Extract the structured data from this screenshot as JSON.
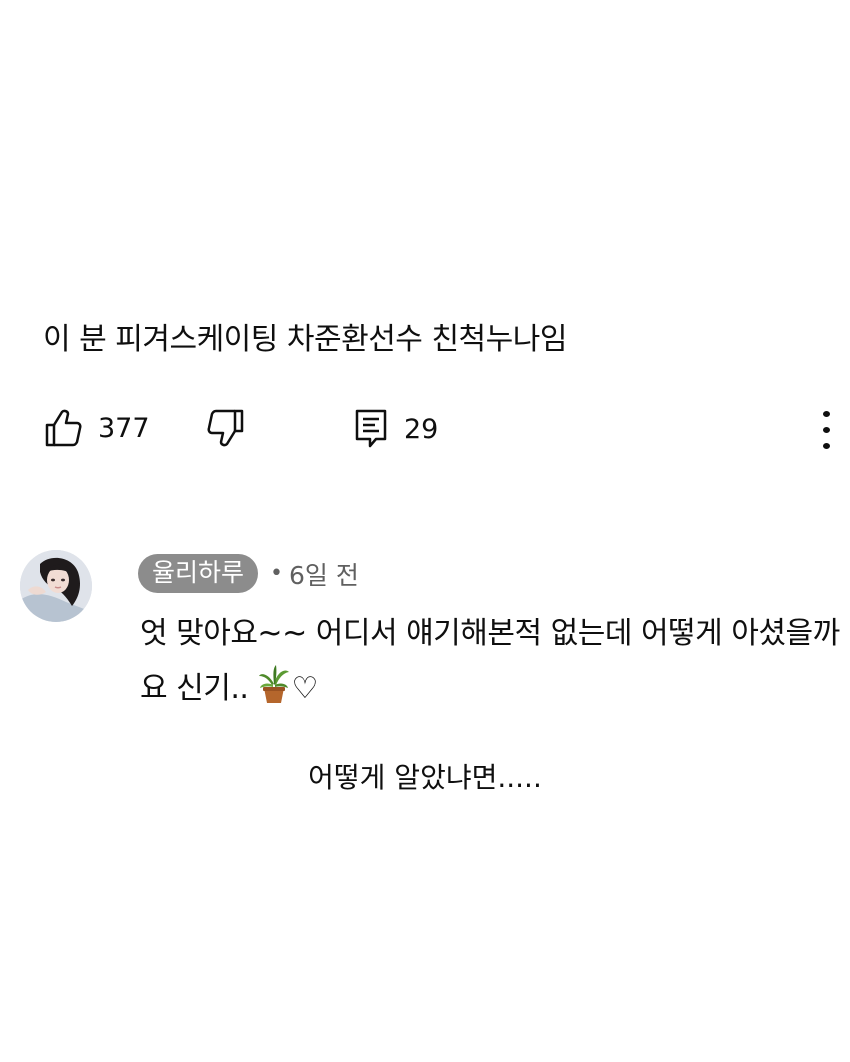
{
  "comment": {
    "text": "이 분 피겨스케이팅 차준환선수 친척누나임",
    "like_count": "377",
    "reply_count": "29"
  },
  "reply": {
    "author": "율리하루",
    "separator": "•",
    "time": "6일 전",
    "text": "엇 맞아요~~ 어디서 얘기해본적 없는데 어떻게 아셨을까요 신기.. ",
    "heart": "♡"
  },
  "caption": "어떻게 알았냐면.....",
  "icons": {
    "like": "thumbs-up-icon",
    "dislike": "thumbs-down-icon",
    "reply": "reply-comment-icon",
    "more": "more-vertical-icon",
    "plant": "potted-plant-emoji"
  },
  "colors": {
    "text": "#0f0f0f",
    "secondary": "#606060",
    "author_pill": "#8c8c8c"
  }
}
